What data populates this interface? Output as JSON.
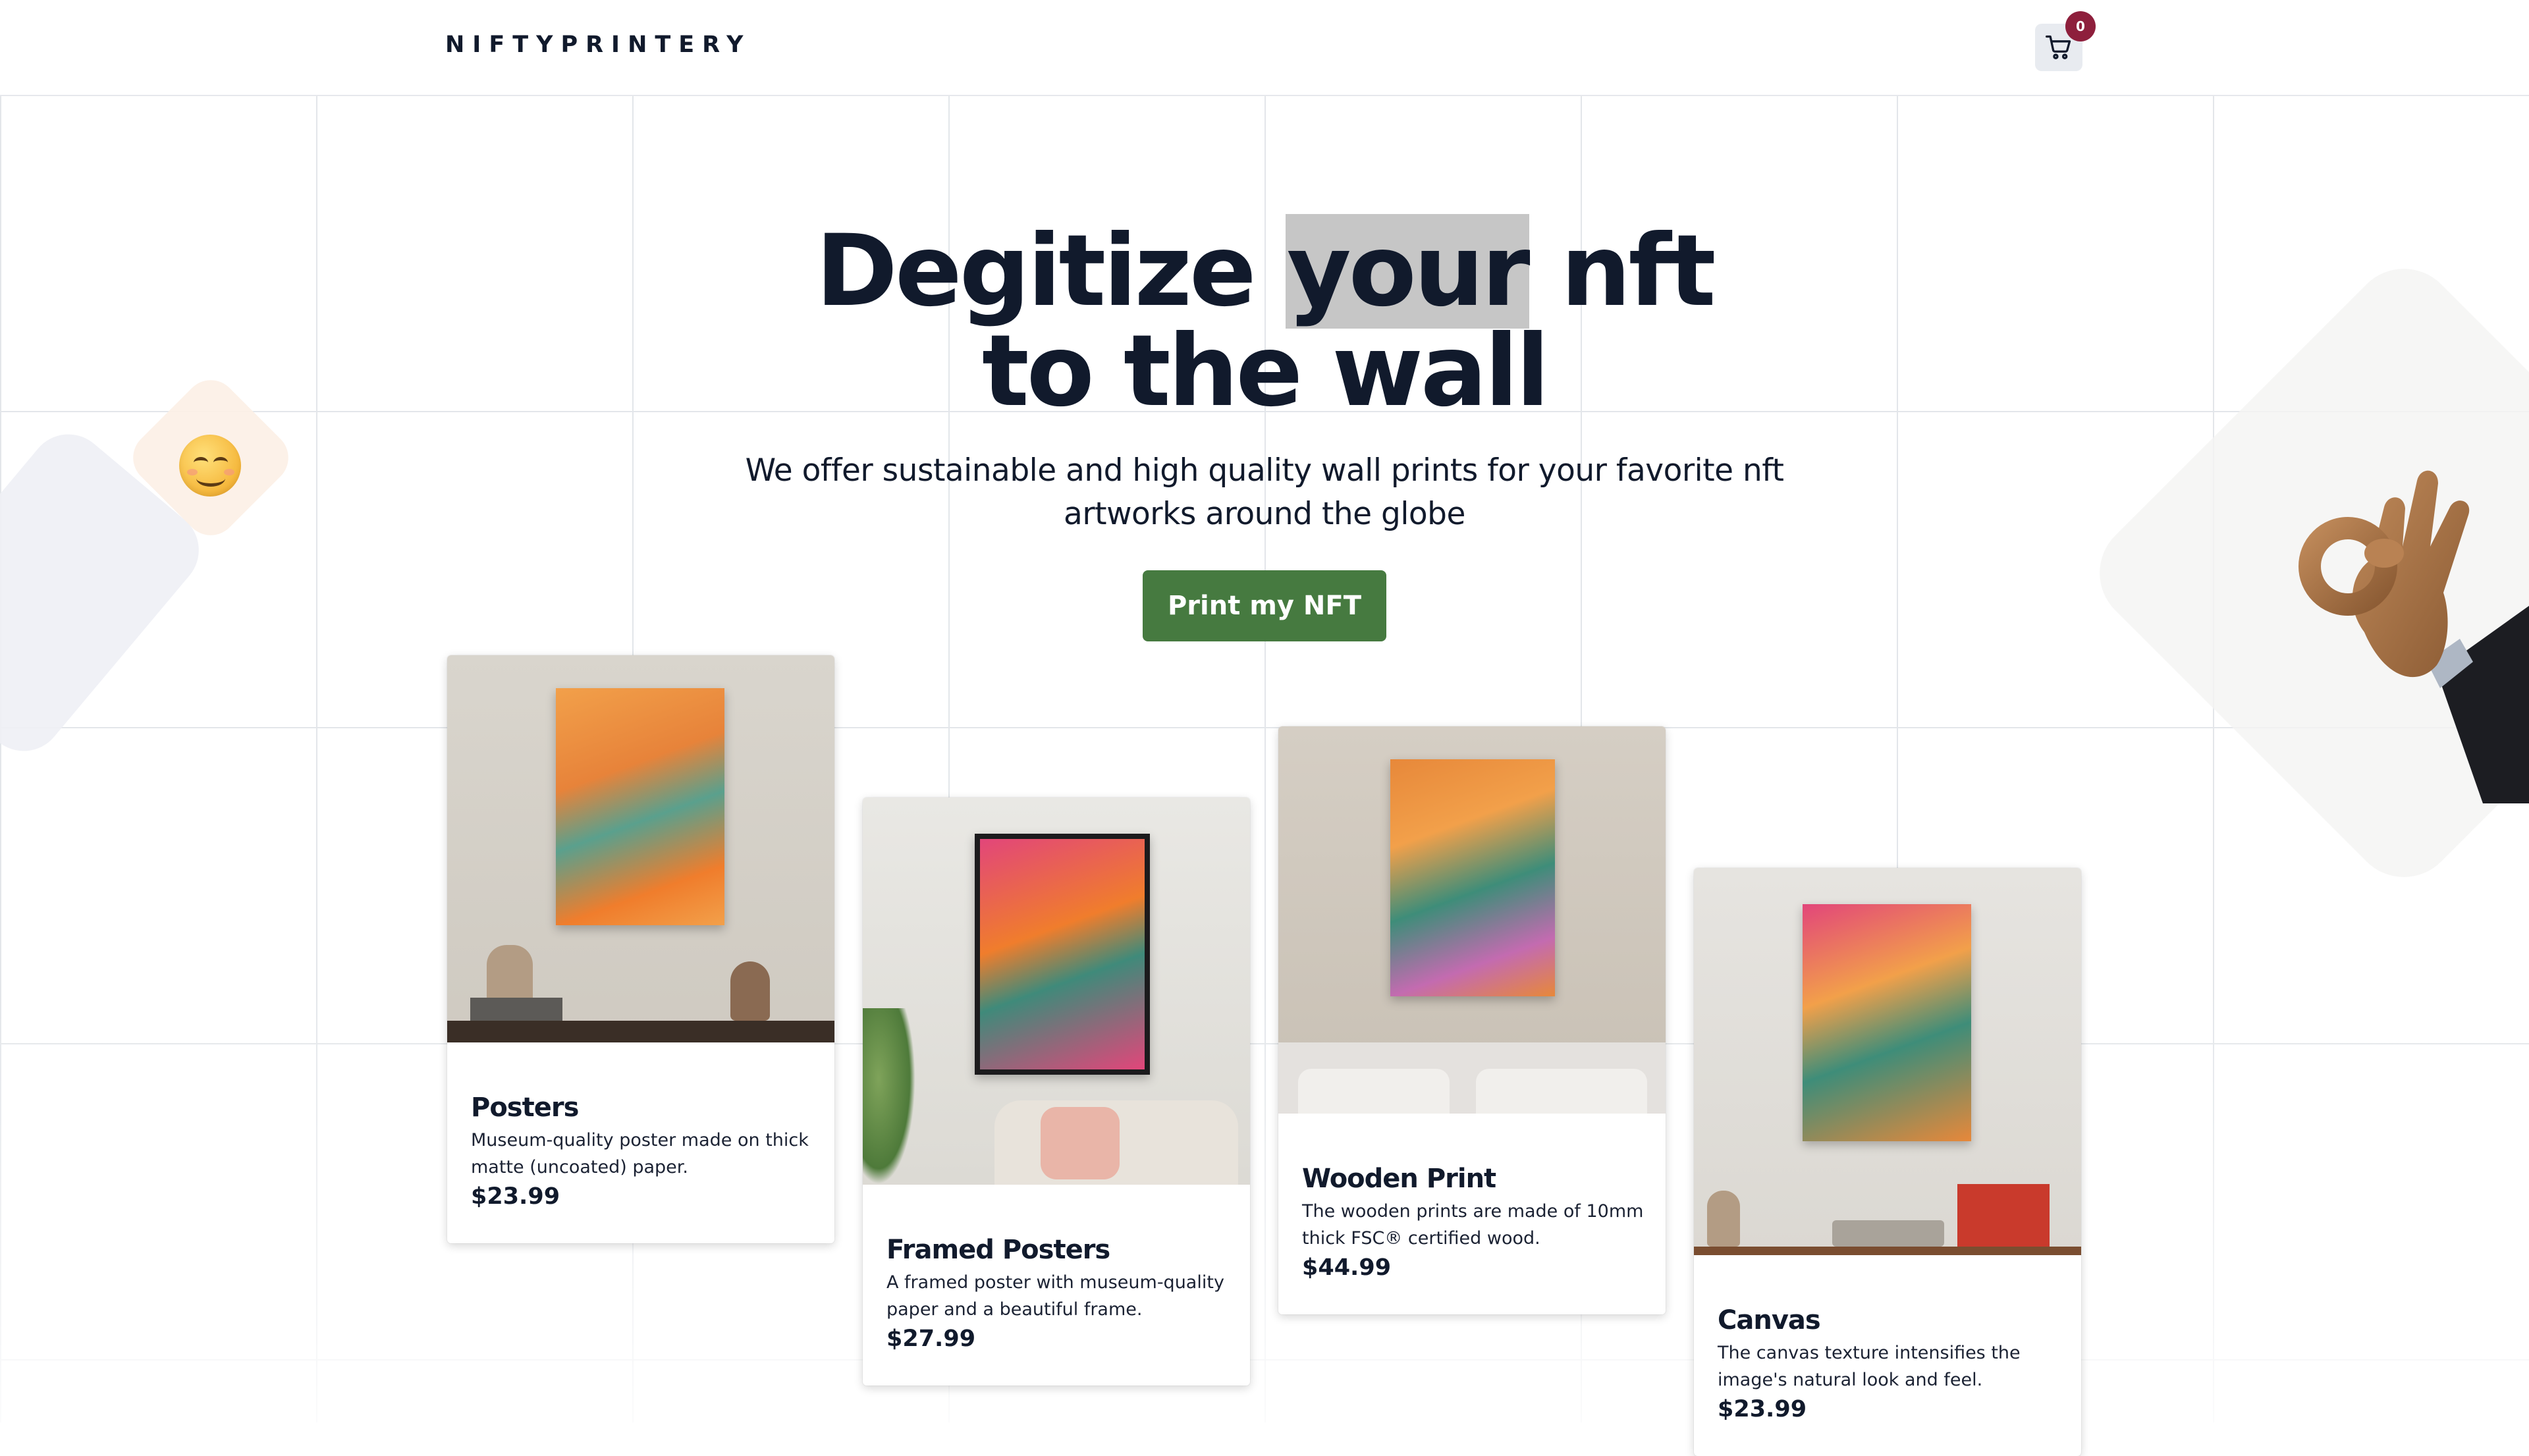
{
  "header": {
    "brand": "NIFTYPRINTERY",
    "cart_count": "0",
    "cart_icon": "cart-icon"
  },
  "hero": {
    "title_word1": "Degitize",
    "title_highlight": "your",
    "title_word3": "nft",
    "title_line2": "to the wall",
    "subtitle": "We offer sustainable and high quality wall prints for your favorite nft artworks around the globe",
    "cta_label": "Print my NFT"
  },
  "products": [
    {
      "title": "Posters",
      "description": "Museum-quality poster made on thick matte (uncoated) paper.",
      "price": "$23.99"
    },
    {
      "title": "Framed Posters",
      "description": "A framed poster with museum-quality paper and a beautiful frame.",
      "price": "$27.99"
    },
    {
      "title": "Wooden Print",
      "description": "The wooden prints are made of 10mm thick FSC® certified wood.",
      "price": "$44.99"
    },
    {
      "title": "Canvas",
      "description": "The canvas texture intensifies the image's natural look and feel.",
      "price": "$23.99"
    }
  ],
  "decorations": {
    "left_emoji": "smiling-face-icon",
    "right_gesture": "ok-hand-icon"
  },
  "colors": {
    "brand_text": "#111a2c",
    "cta": "#467a40",
    "badge": "#8e1f3c",
    "highlight": "#c6c6c6"
  }
}
